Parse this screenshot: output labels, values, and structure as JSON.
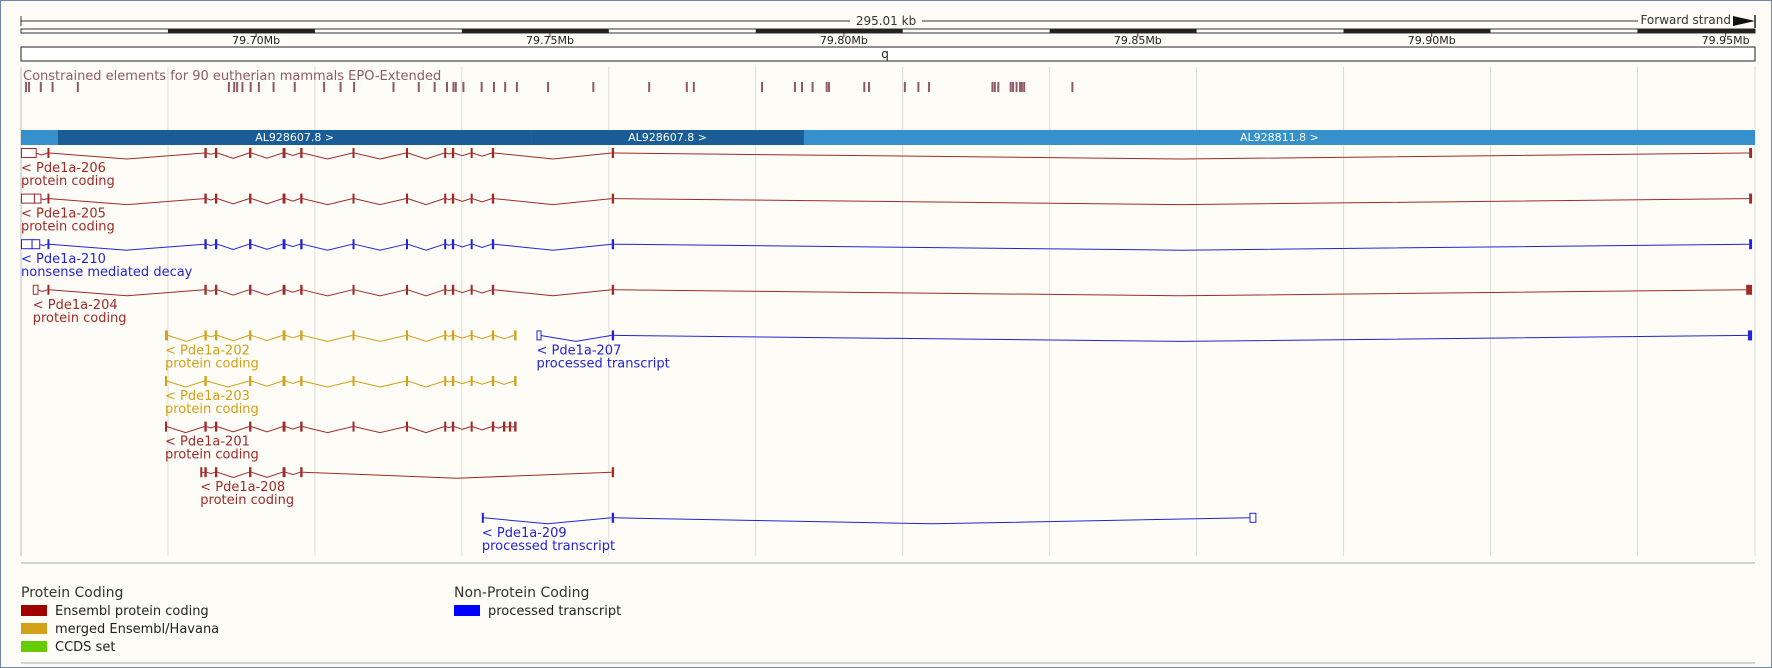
{
  "ruler": {
    "span_label": "295.01 kb",
    "strand_label": "Forward strand",
    "band_label": "q",
    "range_start_mb": 79.66,
    "range_end_mb": 79.955,
    "ticks": [
      {
        "pos": 79.7,
        "label": "79.70Mb"
      },
      {
        "pos": 79.75,
        "label": "79.75Mb"
      },
      {
        "pos": 79.8,
        "label": "79.80Mb"
      },
      {
        "pos": 79.85,
        "label": "79.85Mb"
      },
      {
        "pos": 79.9,
        "label": "79.90Mb"
      },
      {
        "pos": 79.95,
        "label": "79.95Mb"
      }
    ]
  },
  "constrained": {
    "label": "Constrained elements for 90 eutherian mammals EPO-Extended",
    "color": "#8f5a6a",
    "elements_mb": [
      79.6607,
      79.6612,
      79.6632,
      79.6652,
      79.6695,
      79.6952,
      79.6961,
      79.6966,
      79.6975,
      79.6989,
      79.7003,
      79.7028,
      79.7064,
      79.7114,
      79.7142,
      79.7165,
      79.7232,
      79.7275,
      79.7302,
      79.7323,
      79.7334,
      79.7338,
      79.7351,
      79.7382,
      79.7403,
      79.7422,
      79.7442,
      79.7495,
      79.7572,
      79.7667,
      79.7731,
      79.7743,
      79.7859,
      79.7915,
      79.7927,
      79.7945,
      79.7969,
      79.7973,
      79.8033,
      79.8041,
      79.8102,
      79.8125,
      79.8143,
      79.8251,
      79.8255,
      79.8261,
      79.8282,
      79.8286,
      79.8292,
      79.8298,
      79.8301,
      79.8305,
      79.8387
    ]
  },
  "contigs": [
    {
      "label": "AL928607.8 >",
      "start_mb": 79.6663,
      "end_mb": 79.7468,
      "color": "#1a5d96"
    },
    {
      "label": "AL928607.8 >",
      "start_mb": 79.7468,
      "end_mb": 79.7932,
      "color": "#1a5d96"
    },
    {
      "label": "AL928811.8 >",
      "start_mb": 79.7932,
      "end_mb": 79.955,
      "color": "#3590cc"
    }
  ],
  "legend": {
    "protein_heading": "Protein Coding",
    "nonprotein_heading": "Non-Protein Coding",
    "items": [
      {
        "label": "Ensembl protein coding",
        "color": "#a00000"
      },
      {
        "label": "merged Ensembl/Havana",
        "color": "#d4a017"
      },
      {
        "label": "CCDS set",
        "color": "#66cc00"
      },
      {
        "label": "processed transcript",
        "color": "#0000ff"
      }
    ]
  },
  "transcripts": [
    {
      "name": "< Pde1a-206",
      "biotype": "protein coding",
      "color": "#a02a2a",
      "row": 0,
      "start": 79.66,
      "end": 79.9545,
      "exons": [
        [
          79.66,
          79.6625,
          "u"
        ],
        [
          79.6645,
          79.6648,
          "c"
        ],
        [
          79.6912,
          79.6916,
          "c"
        ],
        [
          79.693,
          79.6934,
          "c"
        ],
        [
          79.6988,
          79.6992,
          "c"
        ],
        [
          79.7045,
          79.705,
          "c"
        ],
        [
          79.7075,
          79.7079,
          "c"
        ],
        [
          79.7164,
          79.7167,
          "c"
        ],
        [
          79.7255,
          79.7258,
          "c"
        ],
        [
          79.732,
          79.7323,
          "c"
        ],
        [
          79.7333,
          79.7337,
          "c"
        ],
        [
          79.7365,
          79.7368,
          "c"
        ],
        [
          79.7401,
          79.7405,
          "c"
        ],
        [
          79.7605,
          79.7609,
          "c"
        ],
        [
          79.954,
          79.9545,
          "c"
        ]
      ]
    },
    {
      "name": "< Pde1a-205",
      "biotype": "protein coding",
      "color": "#a02a2a",
      "row": 1,
      "start": 79.66,
      "end": 79.9545,
      "exons": [
        [
          79.66,
          79.6622,
          "u"
        ],
        [
          79.6622,
          79.6633,
          "u"
        ],
        [
          79.6645,
          79.6648,
          "c"
        ],
        [
          79.6912,
          79.6916,
          "c"
        ],
        [
          79.693,
          79.6934,
          "c"
        ],
        [
          79.6988,
          79.6992,
          "c"
        ],
        [
          79.7045,
          79.705,
          "c"
        ],
        [
          79.7075,
          79.7079,
          "c"
        ],
        [
          79.7164,
          79.7167,
          "c"
        ],
        [
          79.7255,
          79.7258,
          "c"
        ],
        [
          79.732,
          79.7323,
          "c"
        ],
        [
          79.7333,
          79.7337,
          "c"
        ],
        [
          79.7365,
          79.7368,
          "c"
        ],
        [
          79.7401,
          79.7405,
          "c"
        ],
        [
          79.7605,
          79.7609,
          "c"
        ],
        [
          79.954,
          79.9545,
          "c"
        ]
      ]
    },
    {
      "name": "< Pde1a-210",
      "biotype": "nonsense mediated decay",
      "color": "#2323d8",
      "row": 2,
      "start": 79.66,
      "end": 79.9545,
      "exons": [
        [
          79.66,
          79.6618,
          "u"
        ],
        [
          79.6618,
          79.6631,
          "u"
        ],
        [
          79.6645,
          79.6648,
          "c"
        ],
        [
          79.6912,
          79.6916,
          "c"
        ],
        [
          79.693,
          79.6934,
          "c"
        ],
        [
          79.6988,
          79.6992,
          "c"
        ],
        [
          79.7045,
          79.705,
          "c"
        ],
        [
          79.7075,
          79.7079,
          "c"
        ],
        [
          79.7164,
          79.7167,
          "c"
        ],
        [
          79.7255,
          79.7258,
          "c"
        ],
        [
          79.732,
          79.7323,
          "c"
        ],
        [
          79.7333,
          79.7337,
          "c"
        ],
        [
          79.7365,
          79.7368,
          "c"
        ],
        [
          79.7401,
          79.7405,
          "c"
        ],
        [
          79.7605,
          79.7609,
          "c"
        ],
        [
          79.954,
          79.9545,
          "c"
        ]
      ]
    },
    {
      "name": "< Pde1a-204",
      "biotype": "protein coding",
      "color": "#a02a2a",
      "row": 3,
      "start": 79.662,
      "end": 79.9545,
      "exons": [
        [
          79.662,
          79.6628,
          "u"
        ],
        [
          79.6645,
          79.6648,
          "c"
        ],
        [
          79.6912,
          79.6916,
          "c"
        ],
        [
          79.693,
          79.6934,
          "c"
        ],
        [
          79.6988,
          79.6992,
          "c"
        ],
        [
          79.7045,
          79.705,
          "c"
        ],
        [
          79.7075,
          79.7079,
          "c"
        ],
        [
          79.7164,
          79.7167,
          "c"
        ],
        [
          79.7255,
          79.7258,
          "c"
        ],
        [
          79.732,
          79.7323,
          "c"
        ],
        [
          79.7333,
          79.7337,
          "c"
        ],
        [
          79.7365,
          79.7368,
          "c"
        ],
        [
          79.7401,
          79.7405,
          "c"
        ],
        [
          79.7605,
          79.7609,
          "c"
        ],
        [
          79.9535,
          79.9545,
          "c"
        ]
      ]
    },
    {
      "name": "< Pde1a-202",
      "biotype": "protein coding",
      "color": "#d4a017",
      "row": 4,
      "start": 79.6845,
      "end": 79.7343,
      "exons": [
        [
          79.6845,
          79.685,
          "c"
        ],
        [
          79.6912,
          79.6916,
          "c"
        ],
        [
          79.693,
          79.6934,
          "c"
        ],
        [
          79.6988,
          79.6992,
          "c"
        ],
        [
          79.7045,
          79.705,
          "c"
        ],
        [
          79.7075,
          79.7079,
          "c"
        ],
        [
          79.7164,
          79.7167,
          "c"
        ],
        [
          79.7255,
          79.7258,
          "c"
        ],
        [
          79.732,
          79.7323,
          "c"
        ],
        [
          79.7333,
          79.7337,
          "c"
        ],
        [
          79.7365,
          79.7368,
          "c"
        ],
        [
          79.7401,
          79.7405,
          "c"
        ],
        [
          79.7439,
          79.7443,
          "c"
        ]
      ]
    },
    {
      "name": "< Pde1a-207",
      "biotype": "processed transcript",
      "color": "#2323d8",
      "row": 4,
      "start": 79.7477,
      "end": 79.9545,
      "exons": [
        [
          79.7477,
          79.7483,
          "u"
        ],
        [
          79.7605,
          79.7609,
          "c"
        ],
        [
          79.9538,
          79.9545,
          "c"
        ]
      ]
    },
    {
      "name": "< Pde1a-203",
      "biotype": "protein coding",
      "color": "#d4a017",
      "row": 5,
      "start": 79.6845,
      "end": 79.7443,
      "exons": [
        [
          79.6845,
          79.6848,
          "c"
        ],
        [
          79.6912,
          79.6916,
          "c"
        ],
        [
          79.6988,
          79.6992,
          "c"
        ],
        [
          79.7045,
          79.705,
          "c"
        ],
        [
          79.7075,
          79.7079,
          "c"
        ],
        [
          79.7164,
          79.7167,
          "c"
        ],
        [
          79.7255,
          79.7258,
          "c"
        ],
        [
          79.732,
          79.7323,
          "c"
        ],
        [
          79.7333,
          79.7337,
          "c"
        ],
        [
          79.7365,
          79.7368,
          "c"
        ],
        [
          79.7401,
          79.7405,
          "c"
        ],
        [
          79.7439,
          79.7443,
          "c"
        ]
      ]
    },
    {
      "name": "< Pde1a-201",
      "biotype": "protein coding",
      "color": "#a02a2a",
      "row": 6,
      "start": 79.6845,
      "end": 79.7443,
      "exons": [
        [
          79.6845,
          79.6848,
          "c"
        ],
        [
          79.6912,
          79.6916,
          "c"
        ],
        [
          79.693,
          79.6934,
          "c"
        ],
        [
          79.6988,
          79.6992,
          "c"
        ],
        [
          79.7045,
          79.705,
          "c"
        ],
        [
          79.7075,
          79.7079,
          "c"
        ],
        [
          79.7164,
          79.7167,
          "c"
        ],
        [
          79.7255,
          79.7258,
          "c"
        ],
        [
          79.732,
          79.7323,
          "c"
        ],
        [
          79.7333,
          79.7337,
          "c"
        ],
        [
          79.7365,
          79.7368,
          "c"
        ],
        [
          79.7401,
          79.7405,
          "c"
        ],
        [
          79.742,
          79.7424,
          "c"
        ],
        [
          79.743,
          79.7434,
          "c"
        ],
        [
          79.7439,
          79.7443,
          "c"
        ]
      ]
    },
    {
      "name": "< Pde1a-208",
      "biotype": "protein coding",
      "color": "#a02a2a",
      "row": 7,
      "start": 79.6905,
      "end": 79.7609,
      "exons": [
        [
          79.6905,
          79.6908,
          "c"
        ],
        [
          79.6912,
          79.6916,
          "c"
        ],
        [
          79.693,
          79.6934,
          "c"
        ],
        [
          79.6988,
          79.6992,
          "c"
        ],
        [
          79.7045,
          79.705,
          "c"
        ],
        [
          79.7075,
          79.7079,
          "c"
        ],
        [
          79.7605,
          79.7609,
          "c"
        ]
      ]
    },
    {
      "name": "< Pde1a-209",
      "biotype": "processed transcript",
      "color": "#2323d8",
      "row": 8,
      "start": 79.7384,
      "end": 79.87,
      "exons": [
        [
          79.7384,
          79.7387,
          "c"
        ],
        [
          79.7605,
          79.7609,
          "c"
        ],
        [
          79.869,
          79.87,
          "u"
        ]
      ]
    }
  ]
}
